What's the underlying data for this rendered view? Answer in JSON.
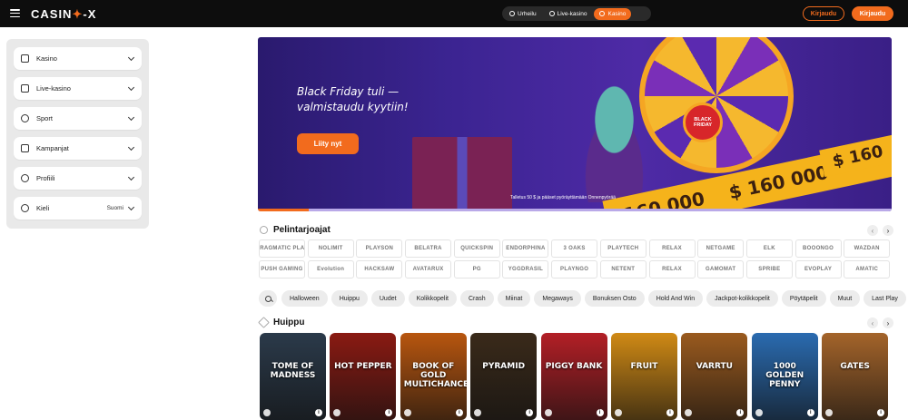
{
  "header": {
    "logo_left": "CASIN",
    "logo_mid": "✦",
    "logo_right": "-X",
    "toggle": [
      {
        "label": "Urheilu",
        "active": false
      },
      {
        "label": "Live-kasino",
        "active": false
      },
      {
        "label": "Kasino",
        "active": true
      }
    ],
    "login_label": "Kirjaudu",
    "signup_label": "Kirjaudu"
  },
  "sidebar": {
    "items": [
      {
        "label": "Kasino",
        "value": ""
      },
      {
        "label": "Live-kasino",
        "value": ""
      },
      {
        "label": "Sport",
        "value": ""
      },
      {
        "label": "Kampanjat",
        "value": ""
      },
      {
        "label": "Profiili",
        "value": ""
      },
      {
        "label": "Kieli",
        "value": "Suomi"
      }
    ]
  },
  "banner": {
    "title": "Black Friday tuli — valmistaudu kyytiin!",
    "cta": "Liity nyt",
    "fine_print": "Talletus 50 $ ja pääset pyöräyttämään Onnenpyörää",
    "wheel_label": "BLACK FRIDAY",
    "amount_1": "$ 160 000",
    "amount_2": "160 000",
    "amount_3": "$ 160",
    "progress": 0.08
  },
  "providers": {
    "title": "Pelintarjoajat",
    "items": [
      "PRAGMATIC PLAY",
      "NOLIMIT",
      "PLAYSON",
      "BELATRA",
      "QUICKSPIN",
      "ENDORPHINA",
      "3 OAKS",
      "PLAYTECH",
      "RELAX",
      "NETGAME",
      "ELK",
      "BOOONGO",
      "WAZDAN",
      "PUSH GAMING",
      "Evolution",
      "HACKSAW",
      "AVATARUX",
      "PG",
      "YGGDRASIL",
      "PLAYNGO",
      "NETENT",
      "RELAX",
      "GAMOMAT",
      "SPRIBE",
      "EVOPLAY",
      "AMATIC"
    ]
  },
  "categories": [
    "Halloween",
    "Huippu",
    "Uudet",
    "Kolikkopelit",
    "Crash",
    "Miinat",
    "Megaways",
    "Bonuksen Osto",
    "Hold And Win",
    "Jackpot-kolikkopelit",
    "Pöytäpelit",
    "Muut",
    "Last Play"
  ],
  "top_games": {
    "title": "Huippu",
    "items": [
      {
        "name": "TOME OF MADNESS",
        "color": "#2b3a4a"
      },
      {
        "name": "HOT PEPPER",
        "color": "#8a1a12"
      },
      {
        "name": "BOOK OF GOLD MULTICHANCE",
        "color": "#b8560f"
      },
      {
        "name": "PYRAMID",
        "color": "#3a2a1a"
      },
      {
        "name": "PIGGY BANK",
        "color": "#b31f26"
      },
      {
        "name": "FRUIT",
        "color": "#d08a15"
      },
      {
        "name": "VARRTU",
        "color": "#9a5a1e"
      },
      {
        "name": "1000 GOLDEN PENNY",
        "color": "#2a6bb0"
      },
      {
        "name": "GATES",
        "color": "#a4642a"
      }
    ]
  }
}
